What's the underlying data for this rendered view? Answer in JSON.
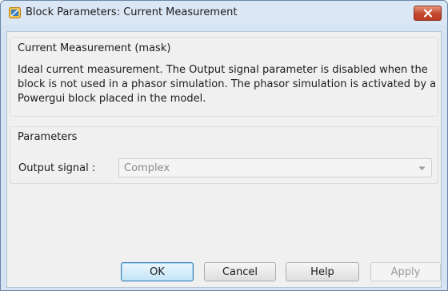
{
  "window": {
    "title": "Block Parameters: Current Measurement"
  },
  "mask": {
    "group_title": "Current Measurement (mask)",
    "description": "Ideal current measurement. The Output signal parameter is disabled when the block is not used in a phasor simulation. The phasor simulation is activated by a Powergui block placed in the model."
  },
  "parameters": {
    "group_title": "Parameters",
    "output_signal_label": "Output signal :",
    "output_signal_value": "Complex",
    "output_signal_enabled": false
  },
  "buttons": {
    "ok": "OK",
    "cancel": "Cancel",
    "help": "Help",
    "apply": "Apply",
    "apply_enabled": false
  },
  "icons": {
    "app": "simulink-block-icon",
    "close": "close-icon",
    "dropdown": "chevron-down-icon"
  },
  "colors": {
    "close_button": "#c3472d",
    "default_button_border": "#3c7fb1",
    "disabled_text": "#8a8a8a"
  }
}
